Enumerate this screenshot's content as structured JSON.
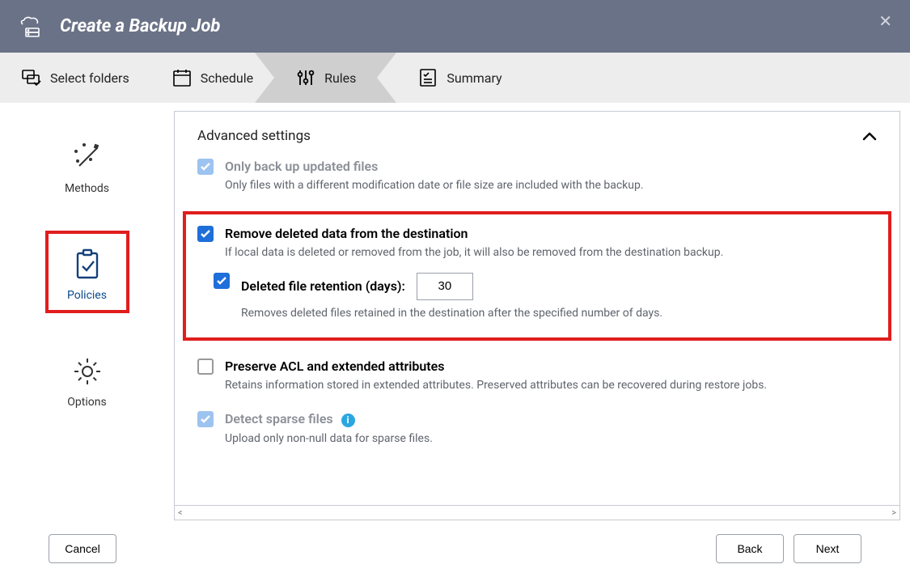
{
  "header": {
    "title": "Create a Backup Job"
  },
  "steps": {
    "select_folders": "Select folders",
    "schedule": "Schedule",
    "rules": "Rules",
    "summary": "Summary"
  },
  "sidebar": {
    "methods": "Methods",
    "policies": "Policies",
    "options": "Options"
  },
  "content": {
    "section_title": "Advanced settings",
    "only_backup_updated_title": "Only back up updated files",
    "only_backup_updated_desc": "Only files with a different modification date or file size are included with the backup.",
    "remove_deleted_title": "Remove deleted data from the destination",
    "remove_deleted_desc": "If local data is deleted or removed from the job, it will also be removed from the destination backup.",
    "retention_label": "Deleted file retention (days):",
    "retention_value": "30",
    "retention_desc": "Removes deleted files retained in the destination after the specified number of days.",
    "preserve_acl_title": "Preserve ACL and extended attributes",
    "preserve_acl_desc": "Retains information stored in extended attributes. Preserved attributes can be recovered during restore jobs.",
    "detect_sparse_title": "Detect sparse files",
    "detect_sparse_desc": "Upload only non-null data for sparse files."
  },
  "footer": {
    "cancel": "Cancel",
    "back": "Back",
    "next": "Next"
  }
}
